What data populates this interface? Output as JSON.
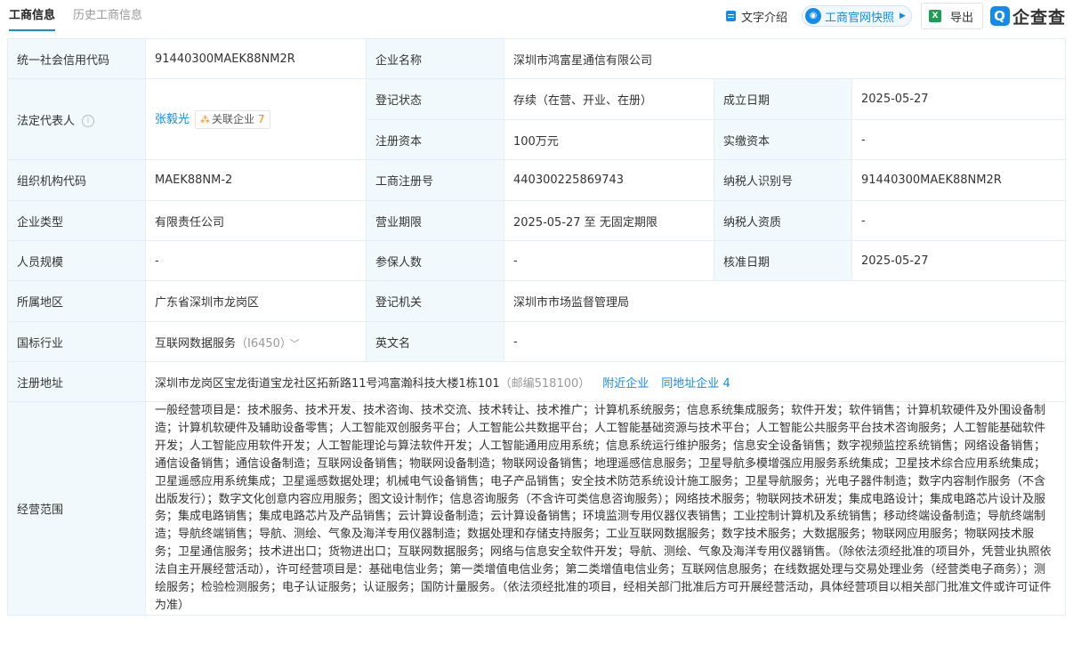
{
  "tabs": [
    {
      "label": "工商信息"
    },
    {
      "label": "历史工商信息"
    }
  ],
  "actions": {
    "text_intro": "文字介绍",
    "snapshot": "工商官网快照",
    "export": "导出",
    "logo_text": "企查查"
  },
  "rows": {
    "credit_code": {
      "label": "统一社会信用代码",
      "value": "91440300MAEK88NM2R"
    },
    "company_name": {
      "label": "企业名称",
      "value": "深圳市鸿富星通信有限公司"
    },
    "legal_rep": {
      "label": "法定代表人",
      "name": "张毅光",
      "related_label": "关联企业",
      "related_count": "7"
    },
    "reg_status": {
      "label": "登记状态",
      "value": "存续（在营、开业、在册）"
    },
    "est_date": {
      "label": "成立日期",
      "value": "2025-05-27"
    },
    "reg_capital": {
      "label": "注册资本",
      "value": "100万元"
    },
    "paid_capital": {
      "label": "实缴资本",
      "value": "-"
    },
    "org_code": {
      "label": "组织机构代码",
      "value": "MAEK88NM-2"
    },
    "reg_no": {
      "label": "工商注册号",
      "value": "440300225869743"
    },
    "taxpayer_id": {
      "label": "纳税人识别号",
      "value": "91440300MAEK88NM2R"
    },
    "company_type": {
      "label": "企业类型",
      "value": "有限责任公司"
    },
    "business_term": {
      "label": "营业期限",
      "value": "2025-05-27 至 无固定期限"
    },
    "taxpayer_qual": {
      "label": "纳税人资质",
      "value": "-"
    },
    "staff_size": {
      "label": "人员规模",
      "value": "-"
    },
    "insured": {
      "label": "参保人数",
      "value": "-"
    },
    "approval_date": {
      "label": "核准日期",
      "value": "2025-05-27"
    },
    "region": {
      "label": "所属地区",
      "value": "广东省深圳市龙岗区"
    },
    "reg_authority": {
      "label": "登记机关",
      "value": "深圳市市场监督管理局"
    },
    "industry": {
      "label": "国标行业",
      "value": "互联网数据服务",
      "code": "（I6450）"
    },
    "english_name": {
      "label": "英文名",
      "value": "-"
    },
    "address": {
      "label": "注册地址",
      "value": "深圳市龙岗区宝龙街道宝龙社区拓新路11号鸿富瀚科技大楼1栋101",
      "postcode": "（邮编518100）",
      "nearby": "附近企业",
      "same_addr": "同地址企业",
      "same_addr_count": "4"
    },
    "scope": {
      "label": "经营范围",
      "value": "一般经营项目是：技术服务、技术开发、技术咨询、技术交流、技术转让、技术推广；计算机系统服务；信息系统集成服务；软件开发；软件销售；计算机软硬件及外围设备制造；计算机软硬件及辅助设备零售；人工智能双创服务平台；人工智能公共数据平台；人工智能基础资源与技术平台；人工智能公共服务平台技术咨询服务；人工智能基础软件开发；人工智能应用软件开发；人工智能理论与算法软件开发；人工智能通用应用系统；信息系统运行维护服务；信息安全设备销售；数字视频监控系统销售；网络设备销售；通信设备销售；通信设备制造；互联网设备销售；物联网设备制造；物联网设备销售；地理遥感信息服务；卫星导航多模增强应用服务系统集成；卫星技术综合应用系统集成；卫星遥感应用系统集成；卫星遥感数据处理；机械电气设备销售；电子产品销售；安全技术防范系统设计施工服务；卫星导航服务；光电子器件制造；数字内容制作服务（不含出版发行）；数字文化创意内容应用服务；图文设计制作；信息咨询服务（不含许可类信息咨询服务）；网络技术服务；物联网技术研发；集成电路设计；集成电路芯片设计及服务；集成电路销售；集成电路芯片及产品销售；云计算设备制造；云计算设备销售；环境监测专用仪器仪表销售；工业控制计算机及系统销售；移动终端设备制造；导航终端制造；导航终端销售；导航、测绘、气象及海洋专用仪器制造；数据处理和存储支持服务；工业互联网数据服务；数字技术服务；大数据服务；物联网应用服务；物联网技术服务；卫星通信服务；技术进出口；货物进出口；互联网数据服务；网络与信息安全软件开发；导航、测绘、气象及海洋专用仪器销售。（除依法须经批准的项目外，凭营业执照依法自主开展经营活动），许可经营项目是：基础电信业务；第一类增值电信业务；第二类增值电信业务；互联网信息服务；在线数据处理与交易处理业务（经营类电子商务）；测绘服务；检验检测服务；电子认证服务；认证服务；国防计量服务。（依法须经批准的项目，经相关部门批准后方可开展经营活动，具体经营项目以相关部门批准文件或许可证件为准）"
    }
  }
}
